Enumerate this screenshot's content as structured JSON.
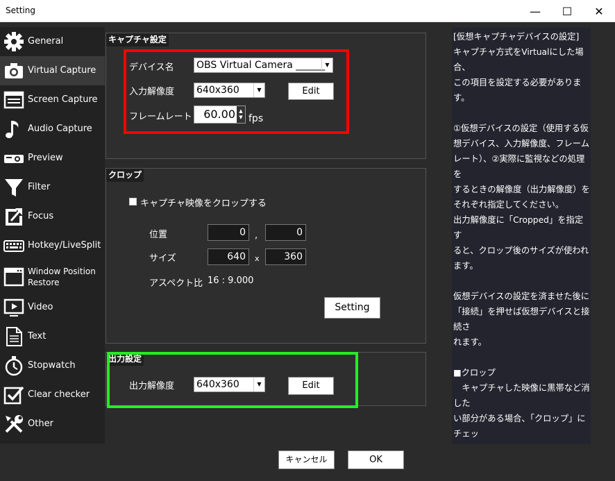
{
  "window": {
    "title": "Setting",
    "min": "—",
    "max": "☐",
    "close": "✕"
  },
  "sidebar": {
    "items": [
      {
        "label": "General",
        "icon": "gear-icon"
      },
      {
        "label": "Virtual Capture",
        "icon": "camera-icon"
      },
      {
        "label": "Screen Capture",
        "icon": "screen-icon"
      },
      {
        "label": "Audio Capture",
        "icon": "music-note-icon"
      },
      {
        "label": "Preview",
        "icon": "projector-icon"
      },
      {
        "label": "Filter",
        "icon": "filter-icon"
      },
      {
        "label": "Focus",
        "icon": "focus-icon"
      },
      {
        "label": "Hotkey/LiveSplit",
        "icon": "keyboard-icon"
      },
      {
        "label": "Window Position",
        "label2": "Restore",
        "icon": "window-icon"
      },
      {
        "label": "Video",
        "icon": "video-icon"
      },
      {
        "label": "Text",
        "icon": "document-icon"
      },
      {
        "label": "Stopwatch",
        "icon": "stopwatch-icon"
      },
      {
        "label": "Clear checker",
        "icon": "checkbox-icon"
      },
      {
        "label": "Other",
        "icon": "tools-icon"
      }
    ],
    "active_index": 1
  },
  "capture": {
    "title": "キャプチャ設定",
    "device_label": "デバイス名",
    "device_value": "OBS Virtual Camera ______",
    "resolution_label": "入力解像度",
    "resolution_value": "640x360",
    "edit": "Edit",
    "framerate_label": "フレームレート",
    "framerate_value": "60.00",
    "fps": "fps"
  },
  "crop": {
    "title": "クロップ",
    "checkbox_label": "キャプチャ映像をクロップする",
    "position_label": "位置",
    "pos_x": "0",
    "comma": ",",
    "pos_y": "0",
    "size_label": "サイズ",
    "width": "640",
    "times": "x",
    "height": "360",
    "aspect_label": "アスペクト比",
    "aspect_value": "16 : 9.000",
    "setting_button": "Setting"
  },
  "output": {
    "title": "出力設定",
    "resolution_label": "出力解像度",
    "resolution_value": "640x360",
    "edit": "Edit"
  },
  "help_text": "[仮想キャプチャデバイスの設定]\nキャプチャ方式をVirtualにした場合、\nこの項目を設定する必要があります。\n\n①仮想デバイスの設定（使用する仮\n想デバイス、入力解像度、フレーム\nレート）、②実際に監視などの処理を\nするときの解像度（出力解像度）を\nそれぞれ指定してください。\n出力解像度に「Cropped」を指定す\nると、クロップ後のサイズが使われます。\n\n仮想デバイスの設定を済ませた後に\n「接続」を押せば仮想デバイスと接続さ\nれます。\n\n■クロップ\n　キャプチャした映像に黒帯など消した\nい部分がある場合、「クロップ」にチェッ\nクを入れて「設定」からクロップ範囲の\n指定をすることで、該当部分を消去す\nることができます。\n\n[ポイント]\n入力解像度、出力解像度が小さいほ\nどPCへの負荷が少なくなります。",
  "footer": {
    "cancel": "キャンセル",
    "ok": "OK"
  },
  "colors": {
    "red_highlight": "#ff0000",
    "green_highlight": "#22ee22"
  }
}
